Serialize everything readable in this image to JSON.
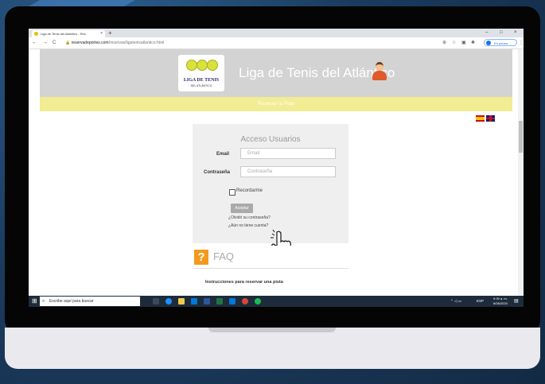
{
  "browser": {
    "tab_title": "Liga de Tenis del Atlántico - Res",
    "tab_close": "×",
    "new_tab": "+",
    "window": {
      "minimize": "–",
      "maximize": "□",
      "close": "×"
    },
    "nav": {
      "back": "←",
      "forward": "→",
      "reload": "C"
    },
    "url_domain": "reservadeportes.com",
    "url_path": "/reservas/ligatenisatlantico.html",
    "profile_label": "En pausa"
  },
  "header": {
    "logo_text": "LIGA DE TENIS",
    "logo_subtext": "DEL ATLÁNTICO",
    "site_title": "Liga de Tenis del Atlántico",
    "reserve_bar_label": "Reservar la Pista"
  },
  "login": {
    "title": "Acceso Usuarios",
    "email_label": "Email",
    "email_placeholder": "Email",
    "password_label": "Contraseña",
    "password_placeholder": "Contraseña",
    "remember_label": "Recordarme",
    "submit_label": "Aceptar",
    "forgot_link": "¿Olvidó su contraseña?",
    "no_account_link": "¿Aún no tiene cuenta?"
  },
  "faq": {
    "icon": "?",
    "title": "FAQ",
    "first_item": "Instrucciones para reservar una pista"
  },
  "taskbar": {
    "search_placeholder": "Escribe aquí para buscar",
    "language": "ESP",
    "time": "9:39 a. m.",
    "date": "6/08/2020"
  },
  "colors": {
    "hero_gray": "#d3d3d3",
    "reserve_yellow": "#f2ec92",
    "faq_orange": "#f39a1c",
    "taskbar": "#1e2b3a"
  }
}
